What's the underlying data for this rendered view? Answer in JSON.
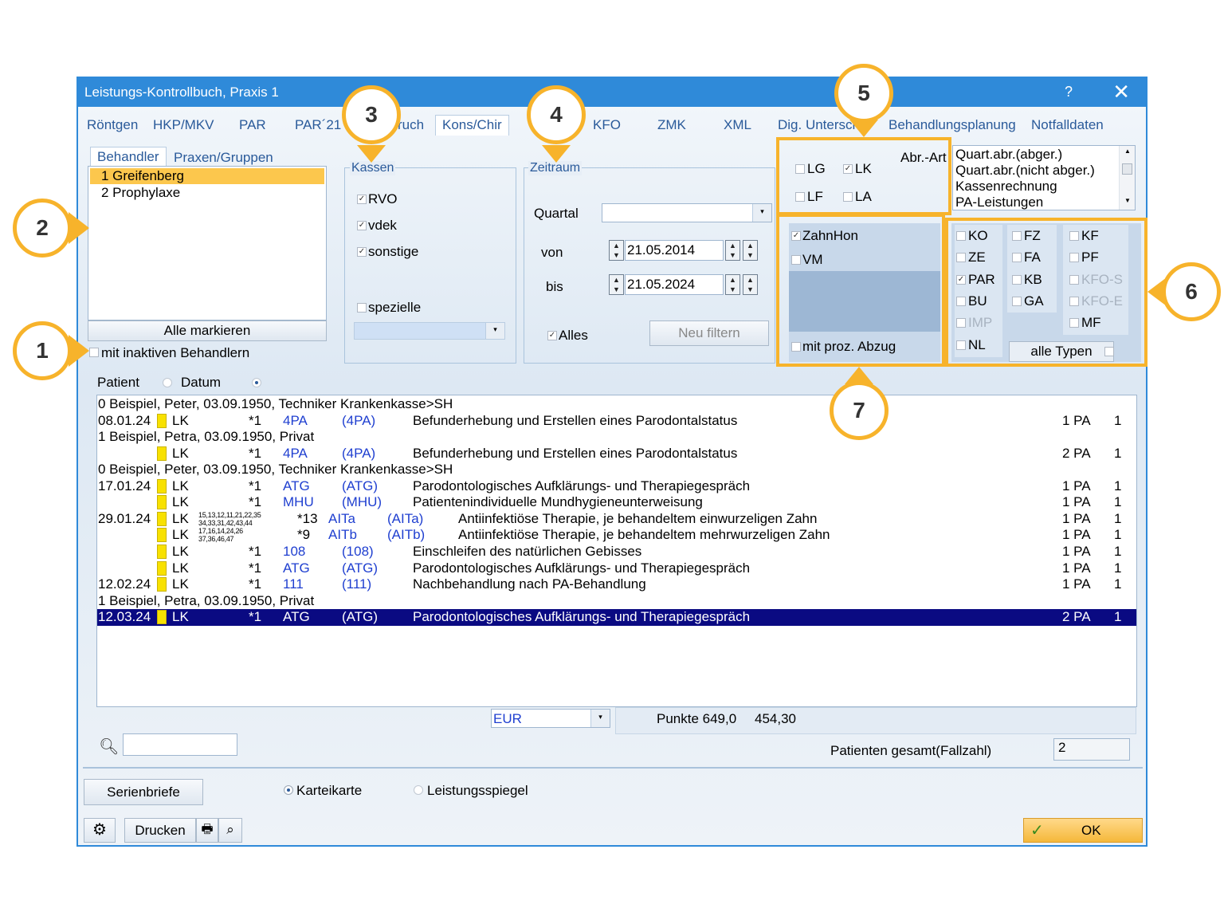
{
  "window": {
    "title": "Leistungs-Kontrollbuch, Praxis 1",
    "help_label": "?",
    "close_label": "✕"
  },
  "tabs": [
    "Röntgen",
    "HKP/MKV",
    "PAR",
    "PAR´21",
    "ruch",
    "Kons/Chir",
    "KFO",
    "ZMK",
    "XML",
    "Dig. Untersch",
    "Behandlungsplanung",
    "Notfalldaten"
  ],
  "behandler": {
    "tab_active": "Behandler",
    "tab_other": "Praxen/Gruppen",
    "items": [
      "1 Greifenberg",
      "2 Prophylaxe"
    ],
    "mark_all_button": "Alle markieren",
    "inactive_label": "mit inaktiven Behandlern"
  },
  "kassen": {
    "title": "Kassen",
    "options": [
      {
        "label": "RVO",
        "checked": true
      },
      {
        "label": "vdek",
        "checked": true
      },
      {
        "label": "sonstige",
        "checked": true
      },
      {
        "label": "spezielle",
        "checked": false
      }
    ]
  },
  "zeitraum": {
    "title": "Zeitraum",
    "quartal_label": "Quartal",
    "von_label": "von",
    "von_value": "21.05.2014",
    "bis_label": "bis",
    "bis_value": "21.05.2024",
    "alles_label": "Alles",
    "alles_checked": true,
    "filter_button": "Neu filtern"
  },
  "abr_art": {
    "title": "Abr.-Art",
    "options": [
      {
        "label": "LG",
        "checked": false
      },
      {
        "label": "LK",
        "checked": true
      },
      {
        "label": "LF",
        "checked": false
      },
      {
        "label": "LA",
        "checked": false
      }
    ],
    "list": [
      "Quart.abr.(abger.)",
      "Quart.abr.(nicht abger.)",
      "Kassenrechnung",
      "PA-Leistungen"
    ]
  },
  "honorar": {
    "zahnhon": "ZahnHon",
    "zahnhon_checked": true,
    "vm": "VM",
    "abzug": "mit proz. Abzug"
  },
  "typen": {
    "col1": [
      {
        "label": "KO",
        "checked": false,
        "disabled": false
      },
      {
        "label": "ZE",
        "checked": false,
        "disabled": false
      },
      {
        "label": "PAR",
        "checked": true,
        "disabled": false
      },
      {
        "label": "BU",
        "checked": false,
        "disabled": false
      },
      {
        "label": "IMP",
        "checked": false,
        "disabled": true
      },
      {
        "label": "NL",
        "checked": false,
        "disabled": false
      }
    ],
    "col2": [
      {
        "label": "FZ",
        "checked": false,
        "disabled": false
      },
      {
        "label": "FA",
        "checked": false,
        "disabled": false
      },
      {
        "label": "KB",
        "checked": false,
        "disabled": false
      },
      {
        "label": "GA",
        "checked": false,
        "disabled": false
      }
    ],
    "col3": [
      {
        "label": "KF",
        "checked": false,
        "disabled": false
      },
      {
        "label": "PF",
        "checked": false,
        "disabled": false
      },
      {
        "label": "KFO-S",
        "checked": false,
        "disabled": true
      },
      {
        "label": "KFO-E",
        "checked": false,
        "disabled": true
      },
      {
        "label": "MF",
        "checked": false,
        "disabled": false
      }
    ],
    "all_label": "alle Typen"
  },
  "sort": {
    "patient": "Patient",
    "datum": "Datum"
  },
  "entries": [
    {
      "kind": "header",
      "text": "0 Beispiel, Peter, 03.09.1950, Techniker Krankenkasse>SH"
    },
    {
      "kind": "item",
      "date": "08.01.24",
      "abr": "LK",
      "count": "*1",
      "code": "4PA",
      "code2": "(4PA)",
      "desc": "Befunderhebung und Erstellen eines Parodontalstatus",
      "amount": "1 PA",
      "n": "1"
    },
    {
      "kind": "header",
      "text": "1 Beispiel, Petra, 03.09.1950, Privat"
    },
    {
      "kind": "item",
      "date": "",
      "abr": "LK",
      "count": "*1",
      "code": "4PA",
      "code2": "(4PA)",
      "desc": "Befunderhebung und Erstellen eines Parodontalstatus",
      "amount": "2 PA",
      "n": "1"
    },
    {
      "kind": "header",
      "text": "0 Beispiel, Peter, 03.09.1950, Techniker Krankenkasse>SH"
    },
    {
      "kind": "item",
      "date": "17.01.24",
      "abr": "LK",
      "count": "*1",
      "code": "ATG",
      "code2": "(ATG)",
      "desc": "Parodontologisches Aufklärungs- und Therapiegespräch",
      "amount": "1 PA",
      "n": "1"
    },
    {
      "kind": "item",
      "date": "",
      "abr": "LK",
      "count": "*1",
      "code": "MHU",
      "code2": "(MHU)",
      "desc": "Patientenindividuelle Mundhygieneunterweisung",
      "amount": "1 PA",
      "n": "1"
    },
    {
      "kind": "item",
      "date": "29.01.24",
      "abr": "LK",
      "teeth1": "15,13,12,11,21,22,35",
      "teeth2": "34,33,31,42,43,44",
      "count": "*13",
      "code": "AITa",
      "code2": "(AITa)",
      "desc": "Antiinfektiöse Therapie, je behandeltem einwurzeligen Zahn",
      "amount": "1 PA",
      "n": "1"
    },
    {
      "kind": "item",
      "date": "",
      "abr": "LK",
      "teeth1": "17,16,14,24,26",
      "teeth2": "37,36,46,47",
      "count": "*9",
      "code": "AITb",
      "code2": "(AITb)",
      "desc": "Antiinfektiöse Therapie, je behandeltem mehrwurzeligen Zahn",
      "amount": "1 PA",
      "n": "1"
    },
    {
      "kind": "item",
      "date": "",
      "abr": "LK",
      "count": "*1",
      "code": "108",
      "code2": "(108)",
      "desc": "Einschleifen des natürlichen Gebisses",
      "amount": "1 PA",
      "n": "1"
    },
    {
      "kind": "item",
      "date": "",
      "abr": "LK",
      "count": "*1",
      "code": "ATG",
      "code2": "(ATG)",
      "desc": "Parodontologisches Aufklärungs- und Therapiegespräch",
      "amount": "1 PA",
      "n": "1"
    },
    {
      "kind": "item",
      "date": "12.02.24",
      "abr": "LK",
      "count": "*1",
      "code": "111",
      "code2": "(111)",
      "desc": "Nachbehandlung nach PA-Behandlung",
      "amount": "1 PA",
      "n": "1"
    },
    {
      "kind": "header",
      "text": "1 Beispiel, Petra, 03.09.1950, Privat"
    },
    {
      "kind": "item",
      "selected": true,
      "date": "12.03.24",
      "abr": "LK",
      "count": "*1",
      "code": "ATG",
      "code2": "(ATG)",
      "desc": "Parodontologisches Aufklärungs- und Therapiegespräch",
      "amount": "2 PA",
      "n": "1"
    }
  ],
  "footer": {
    "currency": "EUR",
    "punkte_label": "Punkte 649,0",
    "punkte_value": "454,30",
    "patients_label": "Patienten gesamt(Fallzahl)",
    "patients_value": "2",
    "serienbriefe": "Serienbriefe",
    "karteikarte": "Karteikarte",
    "leistungsspiegel": "Leistungsspiegel",
    "drucken": "Drucken",
    "ok": "OK"
  },
  "callouts": [
    "1",
    "2",
    "3",
    "4",
    "5",
    "6",
    "7"
  ],
  "colors": {
    "accent": "#2f8ad9",
    "highlight": "#f7b32b",
    "selection": "#0a0a82",
    "code_blue": "#1f3fd0",
    "note_yellow": "#f8e100"
  }
}
